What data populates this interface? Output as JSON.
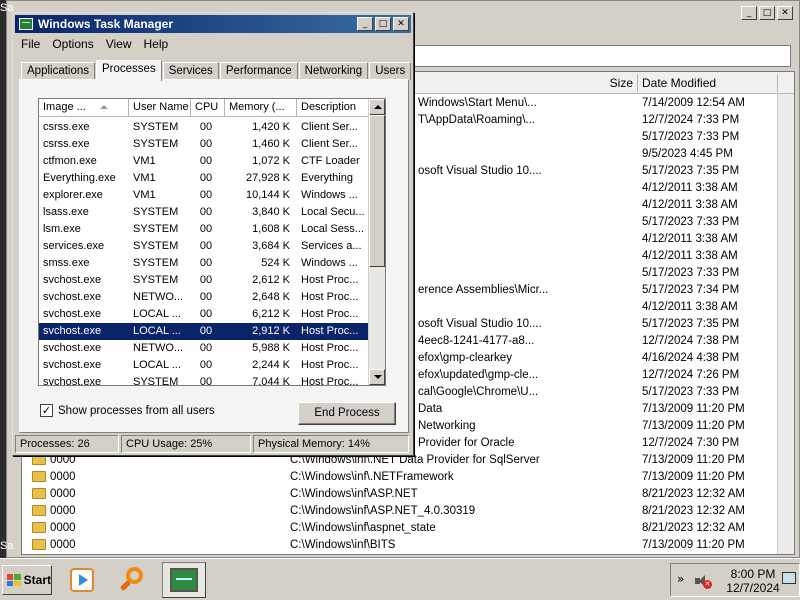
{
  "background_window": {
    "columns": {
      "size": "Size",
      "date_modified": "Date Modified"
    },
    "rows": [
      {
        "name": "",
        "path": "Windows\\Start Menu\\...",
        "date": "7/14/2009 12:54 AM"
      },
      {
        "name": "",
        "path": "T\\AppData\\Roaming\\...",
        "date": "12/7/2024 7:33 PM"
      },
      {
        "name": "",
        "path": "",
        "date": "5/17/2023 7:33 PM"
      },
      {
        "name": "",
        "path": "",
        "date": "9/5/2023 4:45 PM"
      },
      {
        "name": "",
        "path": "osoft Visual Studio 10....",
        "date": "5/17/2023 7:35 PM"
      },
      {
        "name": "",
        "path": "",
        "date": "4/12/2011 3:38 AM"
      },
      {
        "name": "",
        "path": "",
        "date": "4/12/2011 3:38 AM"
      },
      {
        "name": "",
        "path": "",
        "date": "5/17/2023 7:33 PM"
      },
      {
        "name": "",
        "path": "",
        "date": "4/12/2011 3:38 AM"
      },
      {
        "name": "",
        "path": "",
        "date": "4/12/2011 3:38 AM"
      },
      {
        "name": "",
        "path": "",
        "date": "5/17/2023 7:33 PM"
      },
      {
        "name": "",
        "path": "erence Assemblies\\Micr...",
        "date": "5/17/2023 7:34 PM"
      },
      {
        "name": "",
        "path": "",
        "date": "4/12/2011 3:38 AM"
      },
      {
        "name": "",
        "path": "osoft Visual Studio 10....",
        "date": "5/17/2023 7:35 PM"
      },
      {
        "name": "",
        "path": "4eec8-1241-4177-a8...",
        "date": "12/7/2024 7:38 PM"
      },
      {
        "name": "",
        "path": "efox\\gmp-clearkey",
        "date": "4/16/2024 4:38 PM"
      },
      {
        "name": "",
        "path": "efox\\updated\\gmp-cle...",
        "date": "12/7/2024 7:26 PM"
      },
      {
        "name": "",
        "path": "cal\\Google\\Chrome\\U...",
        "date": "5/17/2023 7:33 PM"
      },
      {
        "name": "",
        "path": "Data",
        "date": "7/13/2009 11:20 PM"
      },
      {
        "name": "",
        "path": "Networking",
        "date": "7/13/2009 11:20 PM"
      },
      {
        "name": "",
        "path": "Provider for Oracle",
        "date": "12/7/2024 7:30 PM"
      },
      {
        "name": "0000",
        "path": "C:\\Windows\\inf\\.NET Data Provider for SqlServer",
        "date": "7/13/2009 11:20 PM"
      },
      {
        "name": "0000",
        "path": "C:\\Windows\\inf\\.NETFramework",
        "date": "7/13/2009 11:20 PM"
      },
      {
        "name": "0000",
        "path": "C:\\Windows\\inf\\ASP.NET",
        "date": "8/21/2023 12:32 AM"
      },
      {
        "name": "0000",
        "path": "C:\\Windows\\inf\\ASP.NET_4.0.30319",
        "date": "8/21/2023 12:32 AM"
      },
      {
        "name": "0000",
        "path": "C:\\Windows\\inf\\aspnet_state",
        "date": "8/21/2023 12:32 AM"
      },
      {
        "name": "0000",
        "path": "C:\\Windows\\inf\\BITS",
        "date": "7/13/2009 11:20 PM"
      }
    ],
    "edge_labels": [
      "Sa",
      "Sa"
    ]
  },
  "task_manager": {
    "title": "Windows Task Manager",
    "controls": {
      "minimize": "_",
      "maximize": "□",
      "close": "✕"
    },
    "menu": [
      "File",
      "Options",
      "View",
      "Help"
    ],
    "tabs": [
      "Applications",
      "Processes",
      "Services",
      "Performance",
      "Networking",
      "Users"
    ],
    "active_tab": "Processes",
    "columns": [
      "Image ...",
      "User Name",
      "CPU",
      "Memory (...",
      "Description"
    ],
    "processes": [
      {
        "image": "csrss.exe",
        "user": "SYSTEM",
        "cpu": "00",
        "memory": "1,420 K",
        "desc": "Client Ser..."
      },
      {
        "image": "csrss.exe",
        "user": "SYSTEM",
        "cpu": "00",
        "memory": "1,460 K",
        "desc": "Client Ser..."
      },
      {
        "image": "ctfmon.exe",
        "user": "VM1",
        "cpu": "00",
        "memory": "1,072 K",
        "desc": "CTF Loader"
      },
      {
        "image": "Everything.exe",
        "user": "VM1",
        "cpu": "00",
        "memory": "27,928 K",
        "desc": "Everything"
      },
      {
        "image": "explorer.exe",
        "user": "VM1",
        "cpu": "00",
        "memory": "10,144 K",
        "desc": "Windows ..."
      },
      {
        "image": "lsass.exe",
        "user": "SYSTEM",
        "cpu": "00",
        "memory": "3,840 K",
        "desc": "Local Secu..."
      },
      {
        "image": "lsm.exe",
        "user": "SYSTEM",
        "cpu": "00",
        "memory": "1,608 K",
        "desc": "Local Sess..."
      },
      {
        "image": "services.exe",
        "user": "SYSTEM",
        "cpu": "00",
        "memory": "3,684 K",
        "desc": "Services a..."
      },
      {
        "image": "smss.exe",
        "user": "SYSTEM",
        "cpu": "00",
        "memory": "524 K",
        "desc": "Windows ..."
      },
      {
        "image": "svchost.exe",
        "user": "SYSTEM",
        "cpu": "00",
        "memory": "2,612 K",
        "desc": "Host Proc..."
      },
      {
        "image": "svchost.exe",
        "user": "NETWO...",
        "cpu": "00",
        "memory": "2,648 K",
        "desc": "Host Proc..."
      },
      {
        "image": "svchost.exe",
        "user": "LOCAL ...",
        "cpu": "00",
        "memory": "6,212 K",
        "desc": "Host Proc..."
      },
      {
        "image": "svchost.exe",
        "user": "LOCAL ...",
        "cpu": "00",
        "memory": "2,912 K",
        "desc": "Host Proc..."
      },
      {
        "image": "svchost.exe",
        "user": "NETWO...",
        "cpu": "00",
        "memory": "5,988 K",
        "desc": "Host Proc..."
      },
      {
        "image": "svchost.exe",
        "user": "LOCAL ...",
        "cpu": "00",
        "memory": "2,244 K",
        "desc": "Host Proc..."
      },
      {
        "image": "svchost.exe",
        "user": "SYSTEM",
        "cpu": "00",
        "memory": "7,044 K",
        "desc": "Host Proc..."
      }
    ],
    "selected_index": 12,
    "show_all_label": "Show processes from all users",
    "show_all_checked": true,
    "end_process_label": "End Process",
    "status": {
      "processes": "Processes: 26",
      "cpu": "CPU Usage: 25%",
      "memory": "Physical Memory: 14%"
    }
  },
  "taskbar": {
    "start_label": "Start",
    "apps": [
      {
        "name": "media-player-icon",
        "active": false
      },
      {
        "name": "search-icon",
        "active": false
      },
      {
        "name": "task-manager-icon",
        "active": true
      }
    ],
    "tray_chevron": "»",
    "clock_time": "8:00 PM",
    "clock_date": "12/7/2024"
  },
  "colors": {
    "title_bar": "#0a246a",
    "selection": "#0a246a",
    "window_face": "#d4d0c8",
    "folder": "#e8c14c"
  }
}
